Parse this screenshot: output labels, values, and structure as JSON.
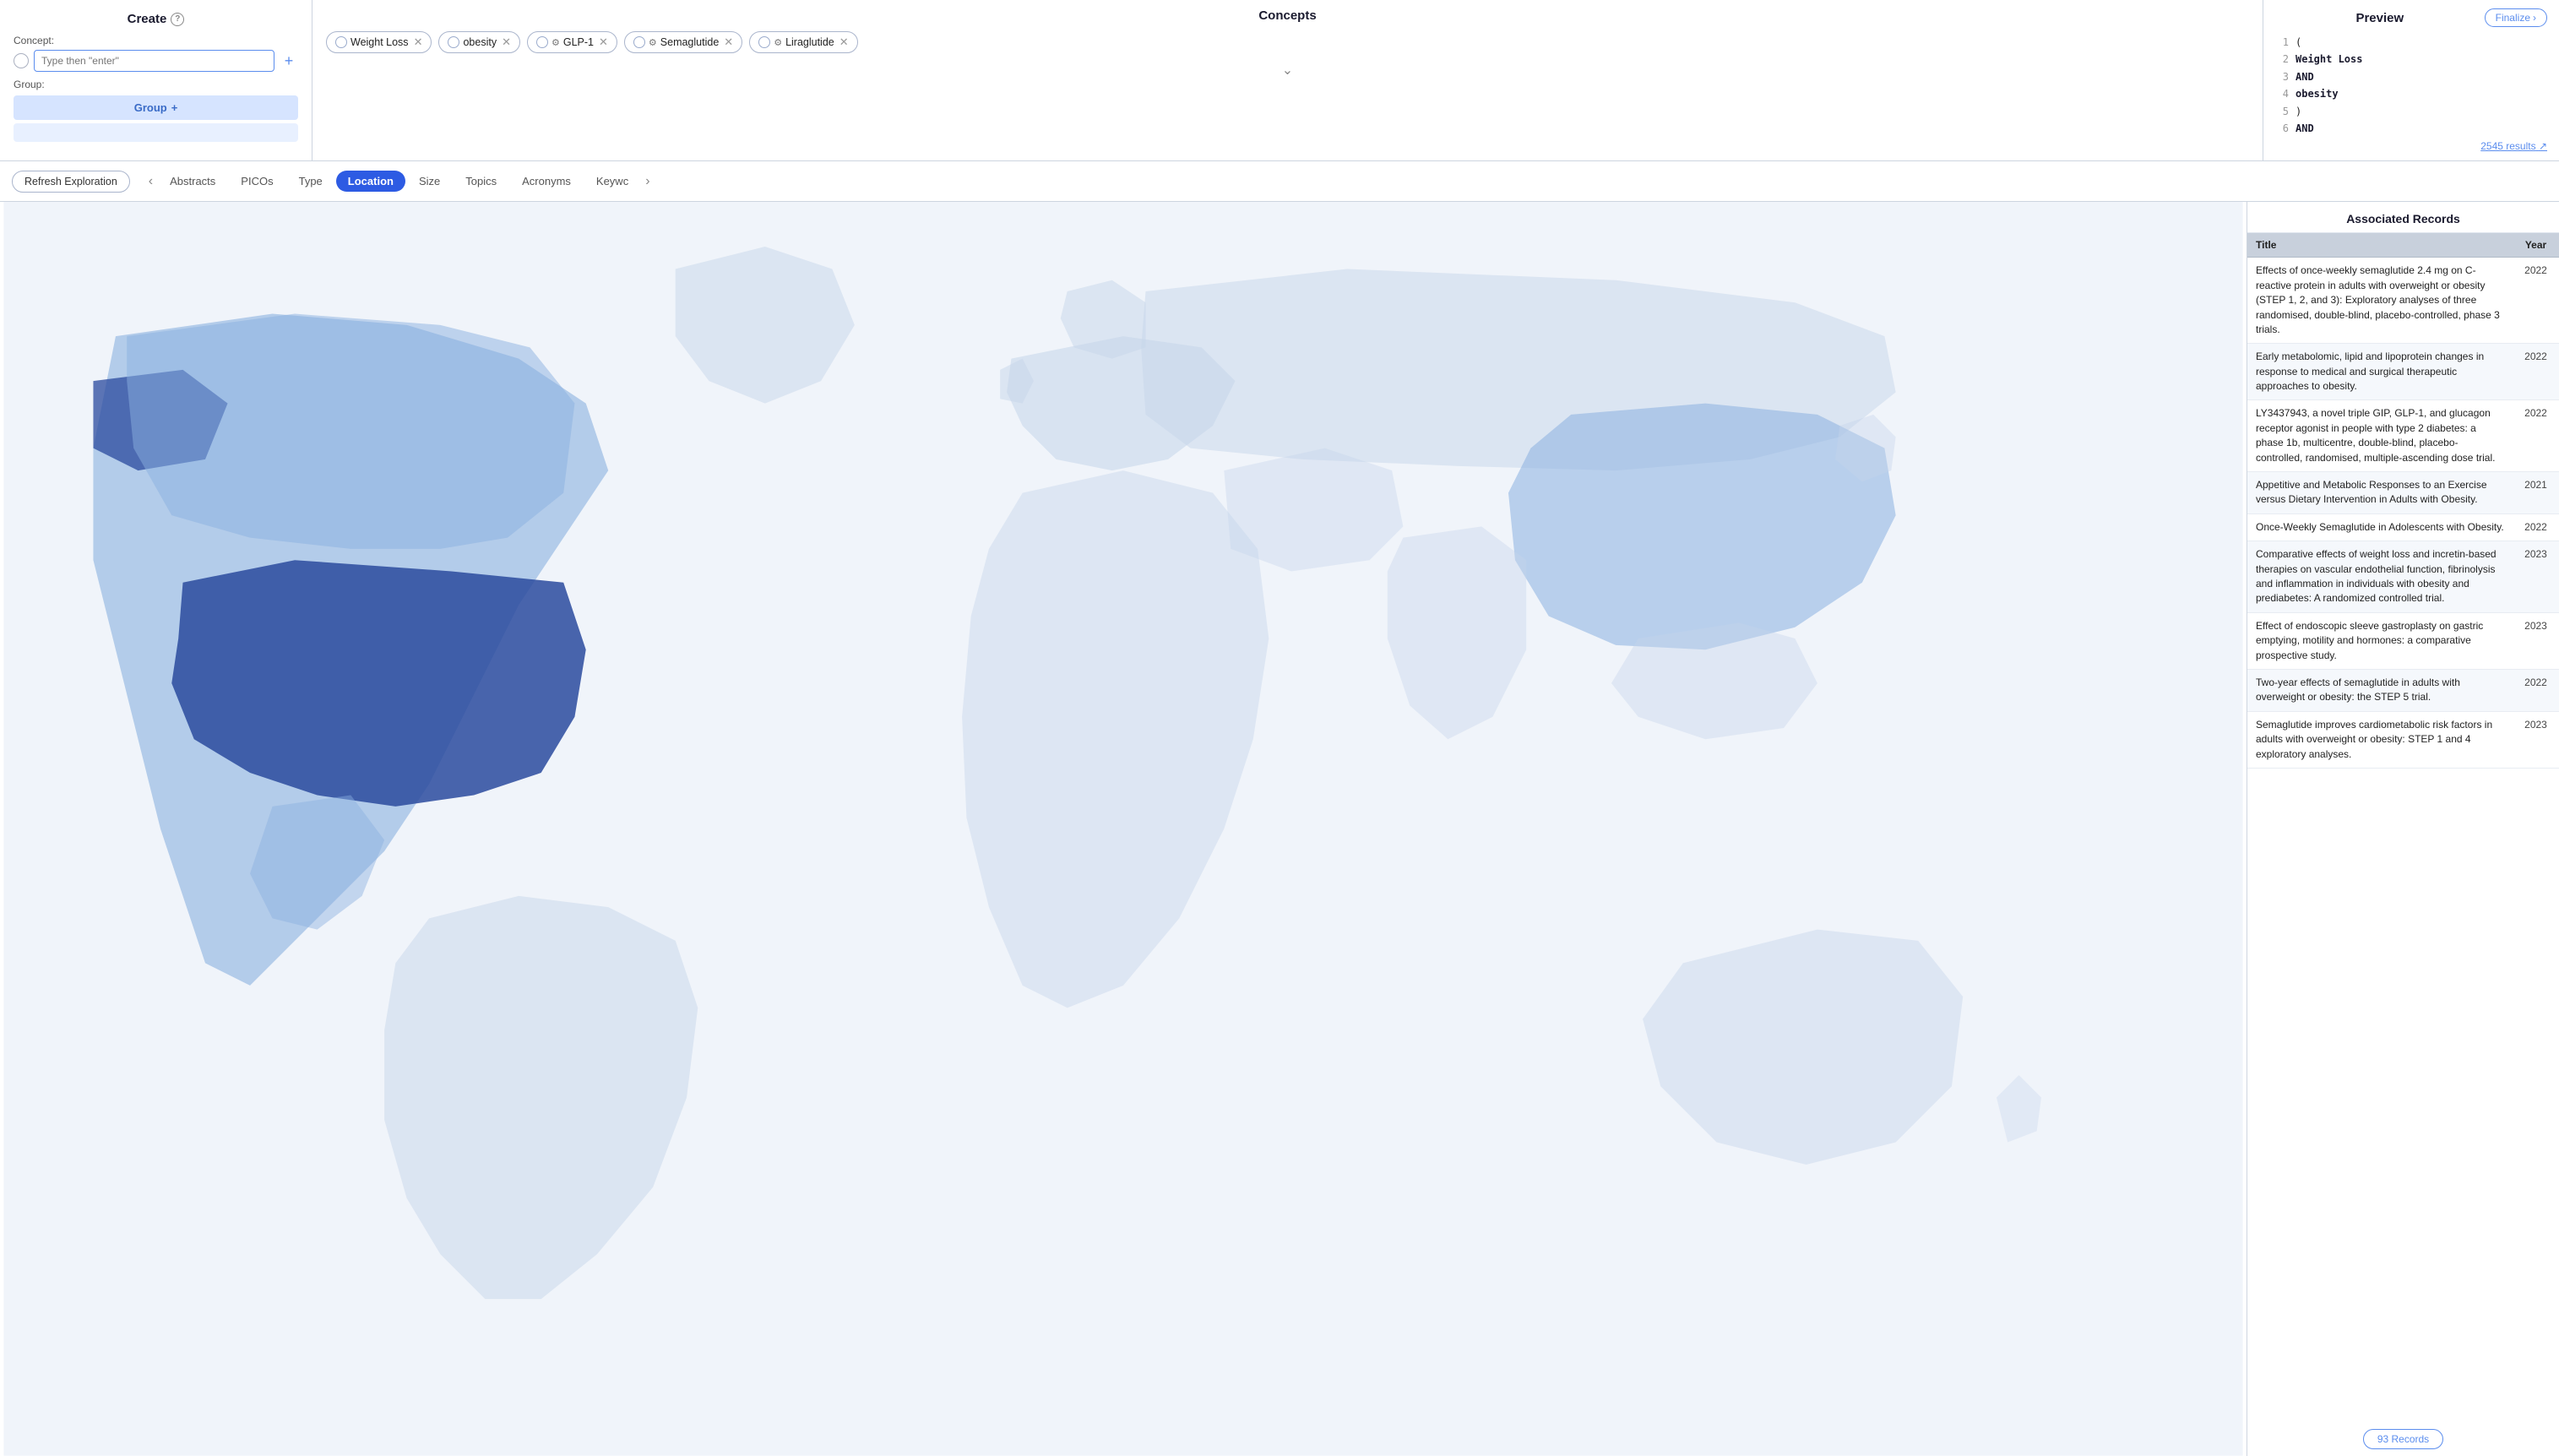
{
  "create": {
    "title": "Create",
    "info_icon": "?",
    "concept_label": "Concept:",
    "concept_placeholder": "Type then \"enter\"",
    "group_label": "Group:",
    "group_button": "Group",
    "add_icon": "+"
  },
  "concepts": {
    "title": "Concepts",
    "tags": [
      {
        "id": 1,
        "label": "Weight Loss",
        "has_gear": false
      },
      {
        "id": 2,
        "label": "obesity",
        "has_gear": false
      },
      {
        "id": 3,
        "label": "GLP-1",
        "has_gear": true
      },
      {
        "id": 4,
        "label": "Semaglutide",
        "has_gear": true
      },
      {
        "id": 5,
        "label": "Liraglutide",
        "has_gear": true
      }
    ]
  },
  "preview": {
    "title": "Preview",
    "finalize_label": "Finalize",
    "finalize_arrow": "›",
    "lines": [
      {
        "num": "1",
        "content": "(",
        "bold": false
      },
      {
        "num": "2",
        "content": "Weight Loss",
        "bold": true
      },
      {
        "num": "3",
        "content": "AND",
        "bold": true
      },
      {
        "num": "4",
        "content": "obesity",
        "bold": true
      },
      {
        "num": "5",
        "content": ")",
        "bold": false
      },
      {
        "num": "6",
        "content": "AND",
        "bold": true
      }
    ],
    "results_count": "2545 results",
    "results_icon": "↗"
  },
  "toolbar": {
    "refresh_label": "Refresh Exploration",
    "tabs": [
      {
        "id": "abstracts",
        "label": "Abstracts",
        "active": false
      },
      {
        "id": "picos",
        "label": "PICOs",
        "active": false
      },
      {
        "id": "type",
        "label": "Type",
        "active": false
      },
      {
        "id": "location",
        "label": "Location",
        "active": true
      },
      {
        "id": "size",
        "label": "Size",
        "active": false
      },
      {
        "id": "topics",
        "label": "Topics",
        "active": false
      },
      {
        "id": "acronyms",
        "label": "Acronyms",
        "active": false
      },
      {
        "id": "keywords",
        "label": "Keywc",
        "active": false
      }
    ]
  },
  "records": {
    "title": "Associated Records",
    "col_title": "Title",
    "col_year": "Year",
    "items": [
      {
        "title": "Effects of once-weekly semaglutide 2.4 mg on C-reactive protein in adults with overweight or obesity (STEP 1, 2, and 3): Exploratory analyses of three randomised, double-blind, placebo-controlled, phase 3 trials.",
        "year": "2022"
      },
      {
        "title": "Early metabolomic, lipid and lipoprotein changes in response to medical and surgical therapeutic approaches to obesity.",
        "year": "2022"
      },
      {
        "title": "LY3437943, a novel triple GIP, GLP-1, and glucagon receptor agonist in people with type 2 diabetes: a phase 1b, multicentre, double-blind, placebo-controlled, randomised, multiple-ascending dose trial.",
        "year": "2022"
      },
      {
        "title": "Appetitive and Metabolic Responses to an Exercise versus Dietary Intervention in Adults with Obesity.",
        "year": "2021"
      },
      {
        "title": "Once-Weekly Semaglutide in Adolescents with Obesity.",
        "year": "2022"
      },
      {
        "title": "Comparative effects of weight loss and incretin-based therapies on vascular endothelial function, fibrinolysis and inflammation in individuals with obesity and prediabetes: A randomized controlled trial.",
        "year": "2023"
      },
      {
        "title": "Effect of endoscopic sleeve gastroplasty on gastric emptying, motility and hormones: a comparative prospective study.",
        "year": "2023"
      },
      {
        "title": "Two-year effects of semaglutide in adults with overweight or obesity: the STEP 5 trial.",
        "year": "2022"
      },
      {
        "title": "Semaglutide improves cardiometabolic risk factors in adults with overweight or obesity: STEP 1 and 4 exploratory analyses.",
        "year": "2023"
      }
    ],
    "count_label": "93 Records"
  }
}
